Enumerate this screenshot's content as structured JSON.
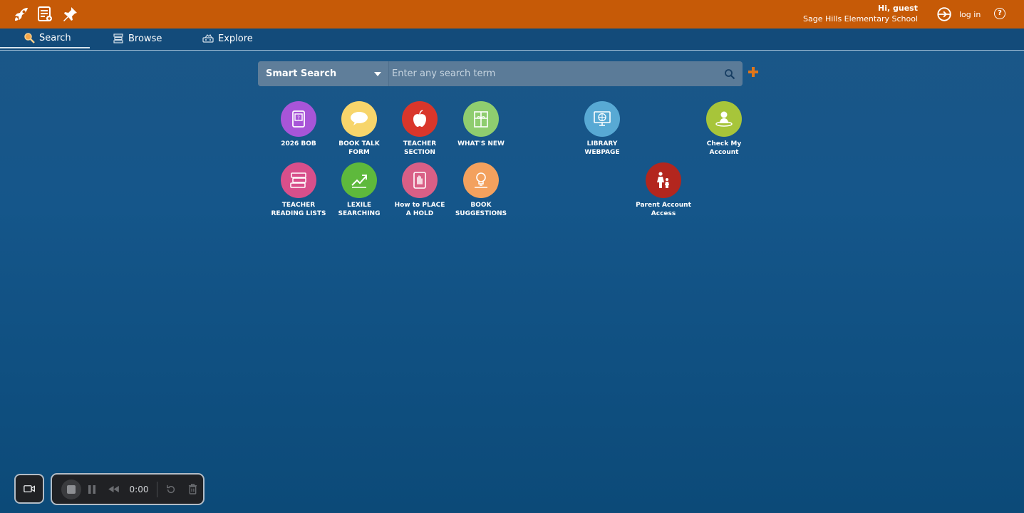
{
  "header": {
    "greeting": "Hi, guest",
    "school": "Sage Hills Elementary School",
    "login_label": "log in",
    "help_label": "?",
    "icons": [
      "rocket-icon",
      "catalog-icon",
      "pin-icon"
    ]
  },
  "tabs": [
    {
      "label": "Search",
      "icon": "search-icon",
      "active": true
    },
    {
      "label": "Browse",
      "icon": "browse-icon",
      "active": false
    },
    {
      "label": "Explore",
      "icon": "explore-icon",
      "active": false
    }
  ],
  "search": {
    "type_label": "Smart Search",
    "placeholder": "Enter any search term",
    "value": ""
  },
  "resources": [
    {
      "label": "2026 BOB",
      "color": "#a855d8",
      "icon": "book-icon"
    },
    {
      "label": "BOOK TALK\nFORM",
      "color": "#f7d56b",
      "icon": "speech-bubble-icon"
    },
    {
      "label": "TEACHER\nSECTION",
      "color": "#d9362b",
      "icon": "apple-icon"
    },
    {
      "label": "WHAT'S NEW",
      "color": "#8fcd6f",
      "icon": "gift-icon"
    },
    {
      "label": "LIBRARY\nWEBPAGE",
      "color": "#58a9d4",
      "icon": "web-icon"
    },
    {
      "label": "Check My\nAccount",
      "color": "#a7c53a",
      "icon": "account-icon"
    },
    {
      "label": "TEACHER\nREADING LISTS",
      "color": "#d84f8b",
      "icon": "book-stack-icon"
    },
    {
      "label": "LEXILE\nSEARCHING",
      "color": "#5eb93c",
      "icon": "chart-up-icon"
    },
    {
      "label": "How to PLACE\nA HOLD",
      "color": "#d95f86",
      "icon": "hand-book-icon"
    },
    {
      "label": "BOOK\nSUGGESTIONS",
      "color": "#f3a15e",
      "icon": "lightbulb-icon"
    },
    {
      "label": "Parent Account\nAccess",
      "color": "#b3261e",
      "icon": "parent-child-icon"
    }
  ],
  "recorder": {
    "time": "0:00"
  },
  "colors": {
    "header": "#c65a07",
    "background": "#15568a",
    "accent_plus": "#e0761a"
  }
}
